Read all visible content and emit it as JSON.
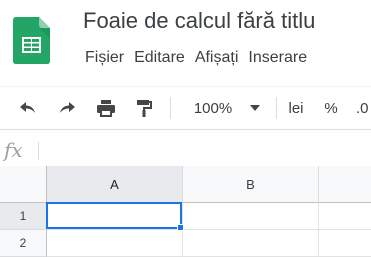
{
  "app": {
    "title": "Foaie de calcul fără titlu",
    "logo_icon": "google-sheets-icon",
    "brand_color": "#23a566"
  },
  "menu": {
    "items": [
      "Fișier",
      "Editare",
      "Afișați",
      "Inserare"
    ]
  },
  "toolbar": {
    "undo_icon": "undo-icon",
    "redo_icon": "redo-icon",
    "print_icon": "print-icon",
    "paint_format_icon": "paint-format-icon",
    "zoom_value": "100%",
    "zoom_dropdown_icon": "chevron-down-icon",
    "currency_label": "lei",
    "percent_label": "%",
    "decimal_label": ".0"
  },
  "formula_bar": {
    "fx_label": "fx",
    "value": ""
  },
  "grid": {
    "columns": [
      "A",
      "B"
    ],
    "rows": [
      "1",
      "2"
    ],
    "active_cell": "A1",
    "selection_color": "#1a73e8"
  }
}
